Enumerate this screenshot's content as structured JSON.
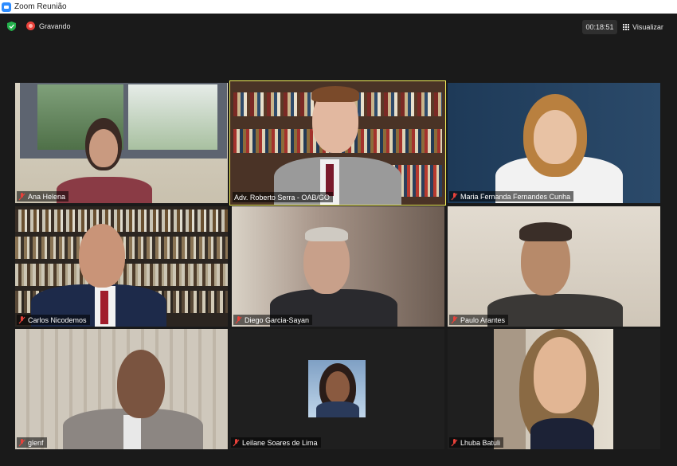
{
  "window": {
    "title": "Zoom Reunião"
  },
  "toolbar": {
    "recording_label": "Gravando",
    "timer": "00:18:51",
    "view_label": "Visualizar"
  },
  "participants": [
    {
      "name": "Ana Helena",
      "muted": true
    },
    {
      "name": "Adv. Roberto Serra - OAB/GO",
      "muted": false,
      "active_speaker": true
    },
    {
      "name": "Maria Fernanda Fernandes Cunha",
      "muted": true
    },
    {
      "name": "Carlos Nicodemos",
      "muted": true
    },
    {
      "name": "Diego Garcia-Sayan",
      "muted": true
    },
    {
      "name": "Paulo Arantes",
      "muted": true
    },
    {
      "name": "glenf",
      "muted": true
    },
    {
      "name": "Leilane Soares de Lima",
      "muted": true,
      "video_off": true
    },
    {
      "name": "Lhuba Batuli",
      "muted": true
    }
  ],
  "colors": {
    "active_speaker_border": "#f2ee5a",
    "recording": "#e8413a",
    "muted_icon": "#e8413a",
    "security_shield": "#23b04b"
  },
  "icons": [
    "zoom-app-icon",
    "shield-icon",
    "record-icon",
    "grid-view-icon",
    "muted-mic-icon"
  ]
}
